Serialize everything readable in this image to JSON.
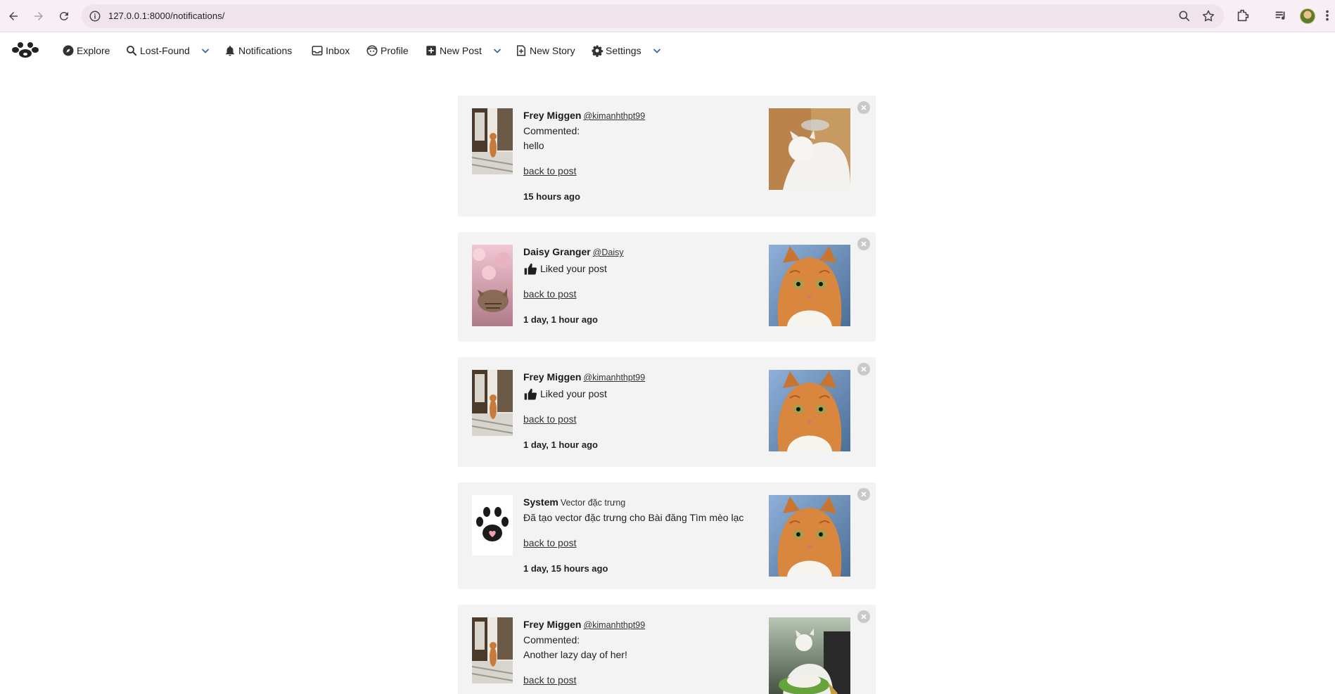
{
  "browser": {
    "url": "127.0.0.1:8000/notifications/"
  },
  "nav": {
    "items": [
      {
        "label": "Explore",
        "icon": "compass-icon"
      },
      {
        "label": "Lost-Found",
        "icon": "search-icon",
        "dropdown": true
      },
      {
        "label": "Notifications",
        "icon": "bell-icon"
      },
      {
        "label": "Inbox",
        "icon": "inbox-icon"
      },
      {
        "label": "Profile",
        "icon": "profile-icon"
      },
      {
        "label": "New Post",
        "icon": "plus-square-icon",
        "dropdown": true
      },
      {
        "label": "New Story",
        "icon": "new-story-icon"
      },
      {
        "label": "Settings",
        "icon": "gear-icon",
        "dropdown": true
      }
    ]
  },
  "notifications": [
    {
      "name": "Frey Miggen",
      "handle": "@kimanhthpt99",
      "action": "Commented:",
      "text": "hello",
      "link": "back to post",
      "time": "15 hours ago",
      "avatar": "cat-window",
      "thumb": "white-cat"
    },
    {
      "name": "Daisy Granger",
      "handle": "@Daisy",
      "action": "Liked your post",
      "link": "back to post",
      "time": "1 day, 1 hour ago",
      "avatar": "cherry-blossom-cat",
      "thumb": "orange-cat"
    },
    {
      "name": "Frey Miggen",
      "handle": "@kimanhthpt99",
      "action": "Liked your post",
      "link": "back to post",
      "time": "1 day, 1 hour ago",
      "avatar": "cat-window",
      "thumb": "orange-cat"
    },
    {
      "name": "System",
      "handle": "Vector đặc trưng",
      "action": "Đã tạo vector đặc trưng cho Bài đăng Tìm mèo lạc",
      "link": "back to post",
      "time": "1 day, 15 hours ago",
      "avatar": "paw-logo",
      "thumb": "orange-cat"
    },
    {
      "name": "Frey Miggen",
      "handle": "@kimanhthpt99",
      "action": "Commented:",
      "text": "Another lazy day of her!",
      "link": "back to post",
      "avatar": "cat-window",
      "thumb": "white-cat-bowl"
    }
  ]
}
